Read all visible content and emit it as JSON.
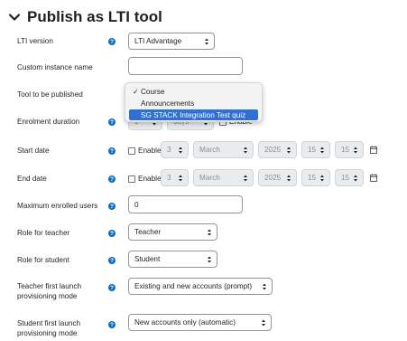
{
  "section": {
    "title": "Publish as LTI tool"
  },
  "fields": {
    "lti_version": {
      "label": "LTI version",
      "value": "LTI Advantage"
    },
    "custom_name": {
      "label": "Custom instance name",
      "value": ""
    },
    "tool": {
      "label": "Tool to be published",
      "options": [
        "Course",
        "Announcements",
        "SG STACK Integration Test quiz"
      ],
      "selected": "Course",
      "highlighted": "SG STACK Integration Test quiz"
    },
    "enrol_duration": {
      "label": "Enrolment duration",
      "value": "1",
      "unit": "days",
      "enable": "Enable"
    },
    "start_date": {
      "label": "Start date",
      "enable": "Enable",
      "day": "3",
      "month": "March",
      "year": "2025",
      "hour": "15",
      "minute": "15"
    },
    "end_date": {
      "label": "End date",
      "enable": "Enable",
      "day": "3",
      "month": "March",
      "year": "2025",
      "hour": "15",
      "minute": "15"
    },
    "max_users": {
      "label": "Maximum enrolled users",
      "value": "0"
    },
    "role_teacher": {
      "label": "Role for teacher",
      "value": "Teacher"
    },
    "role_student": {
      "label": "Role for student",
      "value": "Student"
    },
    "teacher_prov": {
      "label_line1": "Teacher first launch",
      "label_line2": "provisioning mode",
      "value": "Existing and new accounts (prompt)"
    },
    "student_prov": {
      "label_line1": "Student first launch",
      "label_line2": "provisioning mode",
      "value": "New accounts only (automatic)"
    }
  },
  "icons": {
    "help": "question-circle-icon",
    "calendar": "calendar-icon",
    "collapse": "chevron-down-icon"
  },
  "colors": {
    "accent": "#0f6cbf",
    "highlight": "#2f6fd6"
  }
}
